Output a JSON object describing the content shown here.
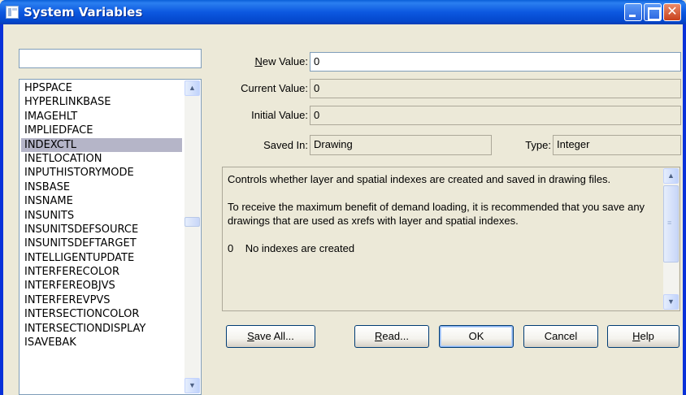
{
  "window": {
    "title": "System Variables"
  },
  "filter": {
    "value": ""
  },
  "variables": [
    "HPSPACE",
    "HYPERLINKBASE",
    "IMAGEHLT",
    "IMPLIEDFACE",
    "INDEXCTL",
    "INETLOCATION",
    "INPUTHISTORYMODE",
    "INSBASE",
    "INSNAME",
    "INSUNITS",
    "INSUNITSDEFSOURCE",
    "INSUNITSDEFTARGET",
    "INTELLIGENTUPDATE",
    "INTERFERECOLOR",
    "INTERFEREOBJVS",
    "INTERFEREVPVS",
    "INTERSECTIONCOLOR",
    "INTERSECTIONDISPLAY",
    "ISAVEBAK"
  ],
  "selected_variable": "INDEXCTL",
  "fields": {
    "new_value_label_accel": "N",
    "new_value_label_rest": "ew Value:",
    "new_value": "0",
    "current_value_label": "Current Value:",
    "current_value": "0",
    "initial_value_label": "Initial Value:",
    "initial_value": "0",
    "saved_in_label": "Saved In:",
    "saved_in": "Drawing",
    "type_label": "Type:",
    "type": "Integer"
  },
  "description": {
    "p1": "Controls whether layer and spatial indexes are created and saved in drawing files.",
    "p2": "To receive the maximum benefit of demand loading, it is recommended that you save any drawings that are used as xrefs with layer and spatial indexes.",
    "p3_code": "0",
    "p3_text": "No indexes are created"
  },
  "buttons": {
    "save_all_accel": "S",
    "save_all_rest": "ave All...",
    "read_accel": "R",
    "read_rest": "ead...",
    "ok": "OK",
    "cancel": "Cancel",
    "help_accel": "H",
    "help_rest": "elp"
  },
  "icons": {
    "window": "system-variables-icon",
    "list_scroll_up": "chevron-up-icon",
    "list_scroll_down": "chevron-down-icon",
    "desc_scroll_up": "chevron-up-icon",
    "desc_scroll_down": "chevron-down-icon"
  },
  "colors": {
    "titlebar": "#0c58e0",
    "selection": "#b5b5c8",
    "dialog_bg": "#ece9d8"
  }
}
